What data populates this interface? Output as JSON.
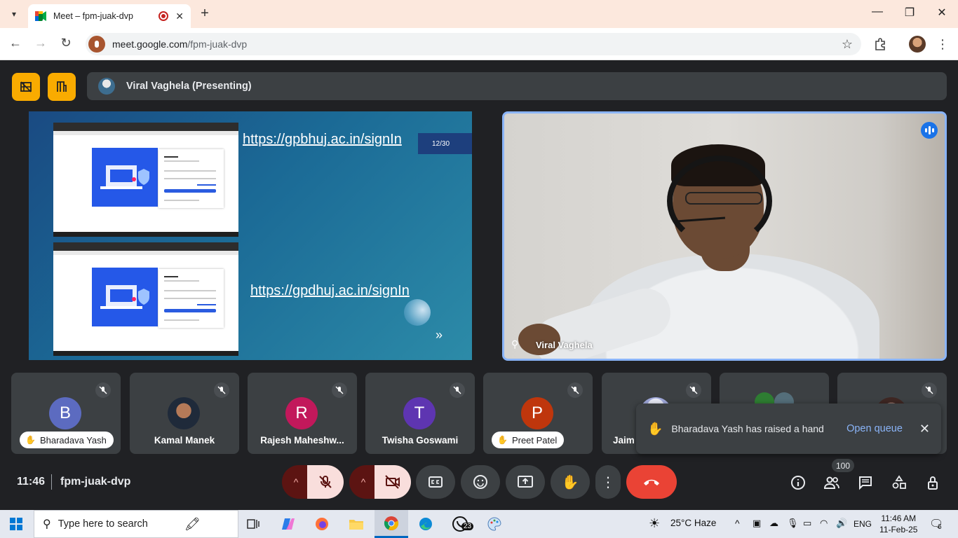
{
  "browser": {
    "tab_title": "Meet – fpm-juak-dvp",
    "new_tab": "+",
    "url_host": "meet.google.com",
    "url_path": "/fpm-juak-dvp",
    "controls": {
      "minimize": "—",
      "maximize": "❐",
      "close": "✕"
    }
  },
  "meet": {
    "presenter_label": "Viral Vaghela (Presenting)",
    "slide": {
      "link1": "https://gpbhuj.ac.in/signIn",
      "link2": "https://gpdhuj.ac.in/signIn",
      "page": "12/30",
      "next": "»"
    },
    "camera_name": "Viral Vaghela",
    "participants": [
      {
        "name": "Bharadava Yash",
        "initial": "B",
        "color": "#5c6bc0",
        "hand_raised": true
      },
      {
        "name": "Kamal Manek",
        "initial": "",
        "color": "#2a8fbf",
        "hand_raised": false
      },
      {
        "name": "Rajesh Maheshw...",
        "initial": "R",
        "color": "#c2185b",
        "hand_raised": false
      },
      {
        "name": "Twisha Goswami",
        "initial": "T",
        "color": "#5e35b1",
        "hand_raised": false
      },
      {
        "name": "Preet Patel",
        "initial": "P",
        "color": "#bf360c",
        "hand_raised": true
      },
      {
        "name": "Jaim",
        "initial": "",
        "color": "#9fa8da",
        "hand_raised": false
      },
      {
        "name": "",
        "initial": "",
        "color": "#2e7d32",
        "hand_raised": false
      },
      {
        "name": "",
        "initial": "",
        "color": "#8d6e63",
        "hand_raised": false
      }
    ],
    "toast": {
      "text": "Bharadava Yash has raised a hand",
      "action": "Open queue"
    },
    "time": "11:46",
    "meeting_code": "fpm-juak-dvp",
    "people_count": "100"
  },
  "taskbar": {
    "search_placeholder": "Type here to search",
    "whatsapp_badge": "23",
    "weather": "25°C  Haze",
    "language": "ENG",
    "time": "11:46 AM",
    "date": "11-Feb-25",
    "notifications": "6"
  }
}
